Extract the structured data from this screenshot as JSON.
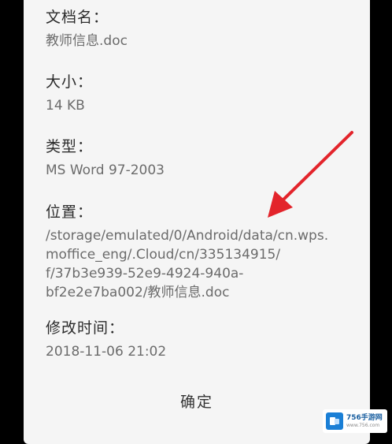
{
  "dialog": {
    "fields": [
      {
        "label": "文档名：",
        "value": "教师信息.doc"
      },
      {
        "label": "大小：",
        "value": "14 KB"
      },
      {
        "label": "类型：",
        "value": "MS Word 97-2003"
      },
      {
        "label": "位置：",
        "value": "/storage/emulated/0/Android/data/cn.wps.\nmoffice_eng/.Cloud/cn/335134915/\nf/37b3e939-52e9-4924-940a-\nbf2e2e7ba002/教师信息.doc"
      },
      {
        "label": "修改时间：",
        "value": "2018-11-06   21:02"
      }
    ],
    "confirm_label": "确定"
  },
  "annotation": {
    "arrow_color": "#e3242b",
    "arrow_icon": "red-arrow-pointing-to-location"
  },
  "watermark": {
    "name": "756手游网",
    "url": "www.756.com",
    "color": "#1a7fd6"
  }
}
